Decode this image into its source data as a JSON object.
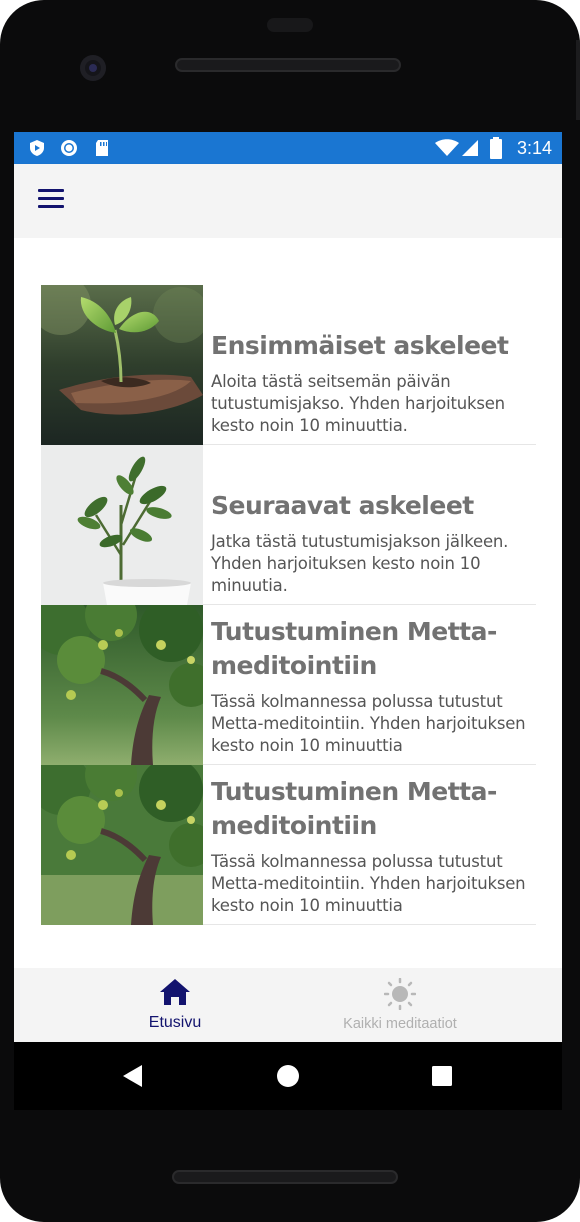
{
  "status_bar": {
    "time": "3:14",
    "icons": [
      "shield-icon",
      "circle-sync-icon",
      "sd-card-icon",
      "wifi-icon",
      "cell-signal-icon",
      "battery-icon"
    ]
  },
  "app_bar": {
    "menu_icon": "hamburger-menu-icon"
  },
  "courses": [
    {
      "title": "Ensimmäiset askeleet",
      "description": "Aloita tästä seitsemän päivän tutustumisjakso. Yhden harjoituksen kesto noin 10 minuuttia.",
      "image": "seedling-in-hand"
    },
    {
      "title": "Seuraavat askeleet",
      "description": "Jatka tästä tutustumisjakson jälkeen. Yhden harjoituksen kesto noin 10 minuutia.",
      "image": "potted-plant"
    },
    {
      "title": "Tutustuminen Metta-meditointiin",
      "description": "Tässä kolmannessa polussa tutustut Metta-meditointiin. Yhden harjoituksen kesto noin 10 minuuttia",
      "image": "apple-tree"
    },
    {
      "title": "Tutustuminen Metta-meditointiin",
      "description": "Tässä kolmannessa polussa tutustut Metta-meditointiin. Yhden harjoituksen kesto noin 10 minuuttia",
      "image": "apple-tree"
    }
  ],
  "bottom_nav": {
    "items": [
      {
        "label": "Etusivu",
        "icon": "home-icon",
        "active": true
      },
      {
        "label": "Kaikki meditaatiot",
        "icon": "sun-icon",
        "active": false
      }
    ]
  },
  "colors": {
    "status_bar": "#1a76d2",
    "accent": "#12136e",
    "inactive": "#b0b0b0",
    "title_text": "#727272"
  }
}
